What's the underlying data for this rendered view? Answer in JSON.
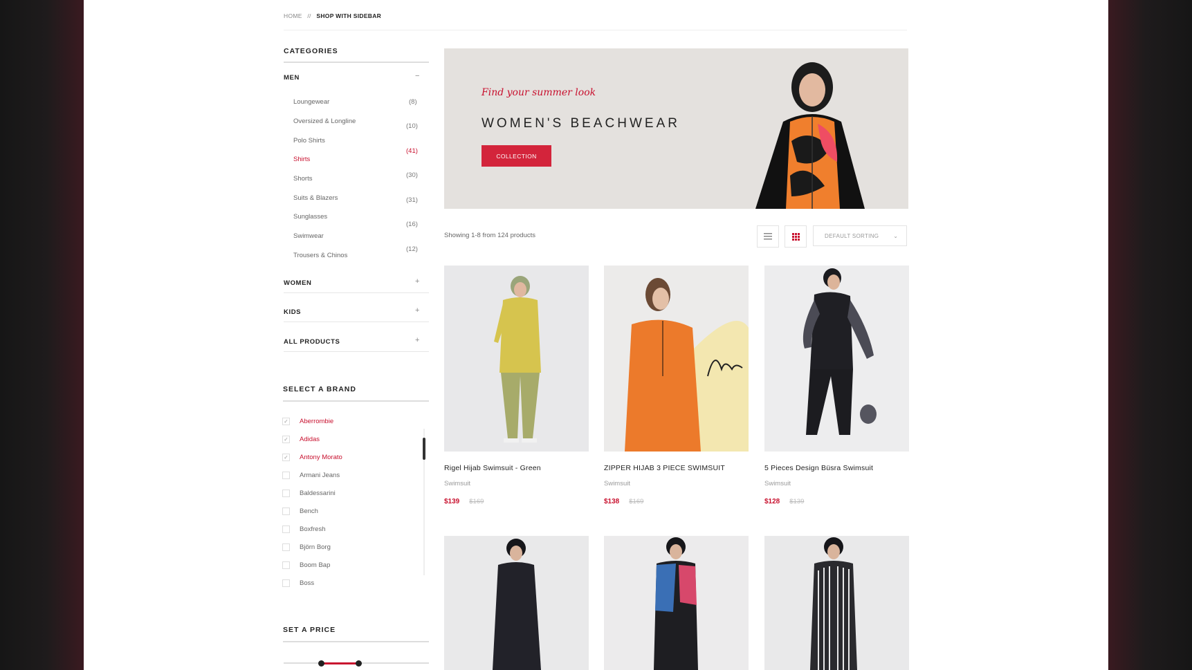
{
  "breadcrumb": {
    "home": "HOME",
    "separator": "//",
    "current": "SHOP WITH SIDEBAR"
  },
  "sidebar": {
    "categories_title": "CATEGORIES",
    "men": {
      "label": "MEN",
      "toggle": "−",
      "items": [
        {
          "label": "Loungewear",
          "active": false
        },
        {
          "label": "Oversized & Longline",
          "active": false
        },
        {
          "label": "Polo Shirts",
          "active": false
        },
        {
          "label": "Shirts",
          "active": true
        },
        {
          "label": "Shorts",
          "active": false
        },
        {
          "label": "Suits & Blazers",
          "active": false
        },
        {
          "label": "Sunglasses",
          "active": false
        },
        {
          "label": "Swimwear",
          "active": false
        },
        {
          "label": "Trousers & Chinos",
          "active": false
        }
      ],
      "counts": [
        "(8)",
        "(10)",
        "(41)",
        "(30)",
        "(31)",
        "(16)",
        "(12)"
      ]
    },
    "collapsed": [
      {
        "label": "WOMEN",
        "toggle": "+"
      },
      {
        "label": "KIDS",
        "toggle": "+"
      },
      {
        "label": "ALL PRODUCTS",
        "toggle": "+"
      }
    ],
    "brand_title": "SELECT A BRAND",
    "brands": [
      {
        "label": "Aberrombie",
        "checked": true
      },
      {
        "label": "Adidas",
        "checked": true
      },
      {
        "label": "Antony Morato",
        "checked": true
      },
      {
        "label": "Armani Jeans",
        "checked": false
      },
      {
        "label": "Baldessarini",
        "checked": false
      },
      {
        "label": "Bench",
        "checked": false
      },
      {
        "label": "Boxfresh",
        "checked": false
      },
      {
        "label": "Björn Borg",
        "checked": false
      },
      {
        "label": "Boom Bap",
        "checked": false
      },
      {
        "label": "Boss",
        "checked": false
      }
    ],
    "price_title": "SET A PRICE"
  },
  "banner": {
    "script": "Find your summer look",
    "title": "WOMEN'S BEACHWEAR",
    "button": "COLLECTION"
  },
  "toolbar": {
    "showing": "Showing 1-8 from 124 products",
    "list_view_icon": "list-icon",
    "grid_view_icon": "grid-icon",
    "sort_label": "DEFAULT SORTING"
  },
  "products": [
    {
      "title": "Rigel Hijab Swimsuit - Green",
      "category": "Swimsuit",
      "price": "$139",
      "old_price": "$169",
      "color": "#d9c85a"
    },
    {
      "title": "ZIPPER HIJAB 3 PIECE SWIMSUIT",
      "category": "Swimsuit",
      "price": "$138",
      "old_price": "$169",
      "color": "#e8772b"
    },
    {
      "title": "5 Pieces Design Büsra Swimsuit",
      "category": "Swimsuit",
      "price": "$128",
      "old_price": "$139",
      "color": "#1f1f24"
    },
    {
      "title": "",
      "category": "",
      "price": "",
      "old_price": "",
      "color": "#22232a"
    },
    {
      "title": "",
      "category": "",
      "price": "",
      "old_price": "",
      "color": "#1e1e22"
    },
    {
      "title": "",
      "category": "",
      "price": "",
      "old_price": "",
      "color": "#333"
    }
  ],
  "colors": {
    "accent": "#c8102e",
    "button": "#d3243b"
  }
}
